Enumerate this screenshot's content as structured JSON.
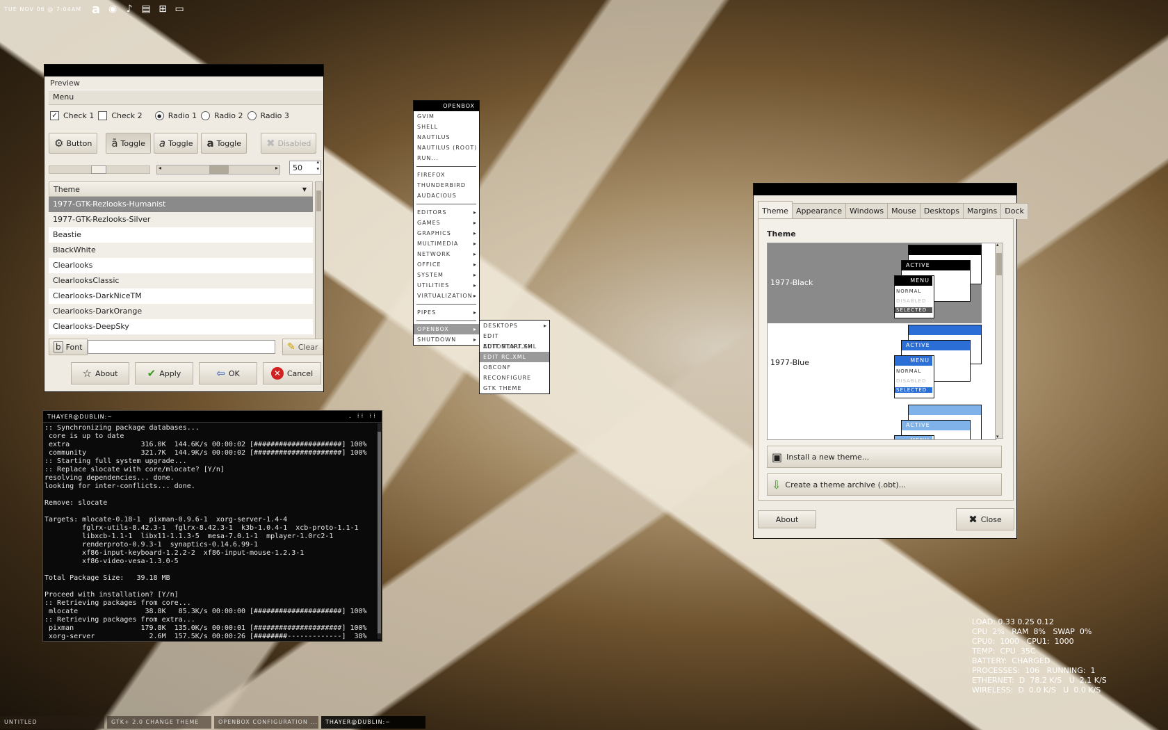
{
  "top_panel": {
    "clock": "TUE NOV 06 @ 7:04AM",
    "tray_icons": [
      "aurora-a-icon",
      "firefox-icon",
      "volume-icon",
      "clipboard-icon",
      "network-icon",
      "display-icon"
    ]
  },
  "gtk_theme_window": {
    "frame_label": "Preview",
    "menu_label": "Menu",
    "checks": [
      {
        "label": "Check 1",
        "checked": true
      },
      {
        "label": "Check 2",
        "checked": false
      }
    ],
    "radios": [
      {
        "label": "Radio 1",
        "selected": true
      },
      {
        "label": "Radio 2",
        "selected": false
      },
      {
        "label": "Radio 3",
        "selected": false
      }
    ],
    "buttons": {
      "button": "Button",
      "toggle1": "Toggle",
      "toggle2": "Toggle",
      "toggle3": "Toggle",
      "disabled": "Disabled"
    },
    "spin_value": "50",
    "theme_column_header": "Theme",
    "themes": [
      "1977-GTK-Rezlooks-Humanist",
      "1977-GTK-Rezlooks-Silver",
      "Beastie",
      "BlackWhite",
      "Clearlooks",
      "ClearlooksClassic",
      "Clearlooks-DarkNiceTM",
      "Clearlooks-DarkOrange",
      "Clearlooks-DeepSky"
    ],
    "selected_theme": "1977-GTK-Rezlooks-Humanist",
    "font_label": "Font",
    "clear_label": "Clear",
    "about_label": "About",
    "apply_label": "Apply",
    "ok_label": "OK",
    "cancel_label": "Cancel"
  },
  "openbox_menu": {
    "title": "OPENBOX",
    "group1": [
      "GVIM",
      "SHELL",
      "NAUTILUS",
      "NAUTILUS (ROOT)",
      "RUN..."
    ],
    "group2": [
      "FIREFOX",
      "THUNDERBIRD",
      "AUDACIOUS"
    ],
    "group3": [
      "EDITORS",
      "GAMES",
      "GRAPHICS",
      "MULTIMEDIA",
      "NETWORK",
      "OFFICE",
      "SYSTEM",
      "UTILITIES",
      "VIRTUALIZATION"
    ],
    "group4": [
      "PIPES"
    ],
    "group5": [
      "OPENBOX",
      "SHUTDOWN"
    ],
    "submenu": [
      "DESKTOPS",
      "EDIT AUTOSTART.SH",
      "EDIT MENU.XML",
      "EDIT RC.XML",
      "OBCONF",
      "RECONFIGURE",
      "GTK THEME"
    ]
  },
  "terminal": {
    "title": "THAYER@DUBLIN:~",
    "lines": [
      ":: Synchronizing package databases...",
      " core is up to date",
      " extra                 316.0K  144.6K/s 00:00:02 [#####################] 100%",
      " community             321.7K  144.9K/s 00:00:02 [#####################] 100%",
      ":: Starting full system upgrade...",
      ":: Replace slocate with core/mlocate? [Y/n]",
      "resolving dependencies... done.",
      "looking for inter-conflicts... done.",
      "",
      "Remove: slocate",
      "",
      "Targets: mlocate-0.18-1  pixman-0.9.6-1  xorg-server-1.4-4",
      "         fglrx-utils-8.42.3-1  fglrx-8.42.3-1  k3b-1.0.4-1  xcb-proto-1.1-1",
      "         libxcb-1.1-1  libx11-1.1.3-5  mesa-7.0.1-1  mplayer-1.0rc2-1",
      "         renderproto-0.9.3-1  synaptics-0.14.6.99-1",
      "         xf86-input-keyboard-1.2.2-2  xf86-input-mouse-1.2.3-1",
      "         xf86-video-vesa-1.3.0-5",
      "",
      "Total Package Size:   39.18 MB",
      "",
      "Proceed with installation? [Y/n]",
      ":: Retrieving packages from core...",
      " mlocate                38.8K   85.3K/s 00:00:00 [#####################] 100%",
      ":: Retrieving packages from extra...",
      " pixman                179.8K  135.0K/s 00:00:01 [#####################] 100%",
      " xorg-server             2.6M  157.5K/s 00:00:26 [########-------------]  38%"
    ]
  },
  "obconf_window": {
    "tabs": [
      "Theme",
      "Appearance",
      "Windows",
      "Mouse",
      "Desktops",
      "Margins",
      "Dock"
    ],
    "active_tab": "Theme",
    "section_title": "Theme",
    "themes": [
      {
        "name": "1977-Black",
        "selected": true,
        "color": "#000000"
      },
      {
        "name": "1977-Blue",
        "selected": false,
        "color": "#2b6fd6"
      },
      {
        "name": "",
        "selected": false,
        "color": "#7fb2e8"
      }
    ],
    "preview_labels": {
      "active": "ACTIVE",
      "menu": "MENU",
      "normal": "NORMAL",
      "disabled": "DISABLED",
      "selected": "SELECTED"
    },
    "install_label": "Install a new theme...",
    "archive_label": "Create a theme archive (.obt)...",
    "about_label": "About",
    "close_label": "Close"
  },
  "conky": [
    "LOAD: 0.33 0.25 0.12",
    "CPU  2%   RAM  8%   SWAP  0%",
    "CPU0:  1000   CPU1:  1000",
    "TEMP:  CPU  35C",
    "BATTERY:  CHARGED",
    "PROCESSES:  106   RUNNING:  1",
    "ETHERNET:  D  78.2 K/S   U  2.1 K/S",
    "WIRELESS:  D  0.0 K/S   U  0.0 K/S"
  ],
  "taskbar": [
    {
      "label": "UNTITLED",
      "active": false
    },
    {
      "label": "GTK+ 2.0 CHANGE THEME",
      "active": false
    },
    {
      "label": "OPENBOX CONFIGURATION ...",
      "active": false
    },
    {
      "label": "THAYER@DUBLIN:~",
      "active": true
    }
  ]
}
